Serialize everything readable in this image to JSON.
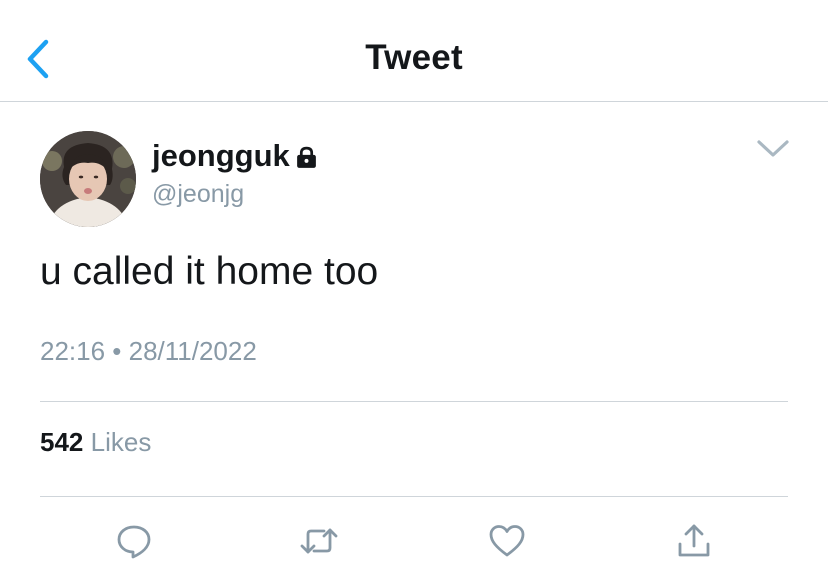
{
  "nav": {
    "title": "Tweet",
    "back_icon": "chevron-left-icon"
  },
  "tweet": {
    "display_name": "jeongguk",
    "protected_icon": "lock-icon",
    "handle": "@jeonjg",
    "text": "u called it home too",
    "timestamp": "22:16 • 28/11/2022",
    "likes_count": "542",
    "likes_label": "Likes"
  },
  "actions": [
    {
      "name": "reply",
      "icon": "reply-icon"
    },
    {
      "name": "retweet",
      "icon": "retweet-icon"
    },
    {
      "name": "like",
      "icon": "heart-icon"
    },
    {
      "name": "share",
      "icon": "share-icon"
    }
  ],
  "colors": {
    "accent": "#1da1f2",
    "text": "#14171a",
    "secondary": "#8899a6",
    "divider": "#cfd5da"
  }
}
